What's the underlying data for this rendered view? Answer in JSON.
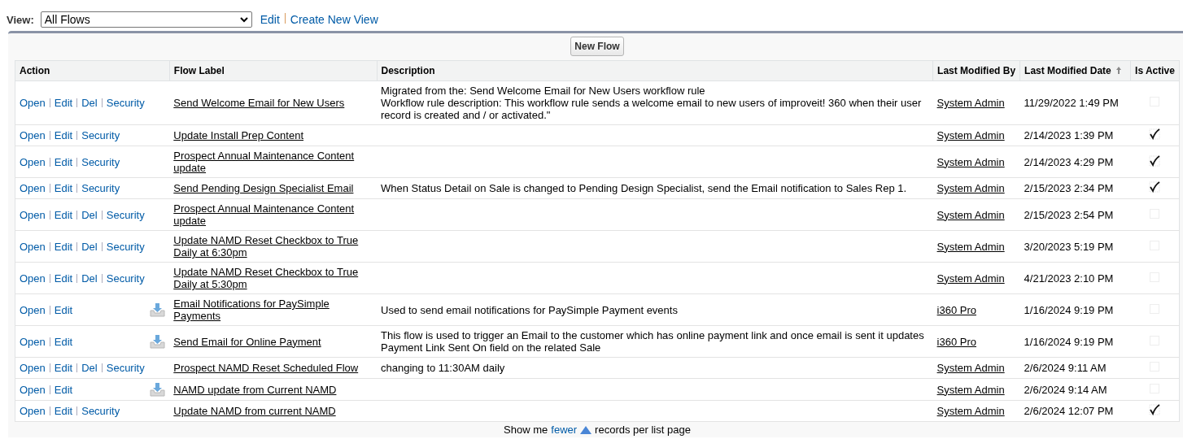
{
  "view_bar": {
    "label": "View:",
    "selected_view": "All Flows",
    "links": [
      "Edit",
      "Create New View"
    ]
  },
  "new_button": "New Flow",
  "table": {
    "columns": [
      {
        "label": "Action",
        "sorted": false
      },
      {
        "label": "Flow Label",
        "sorted": false
      },
      {
        "label": "Description",
        "sorted": false
      },
      {
        "label": "Last Modified By",
        "sorted": false
      },
      {
        "label": "Last Modified Date",
        "sorted": true
      },
      {
        "label": "Is Active",
        "sorted": false
      }
    ],
    "rows": [
      {
        "actions": [
          "Open",
          "Edit",
          "Del",
          "Security"
        ],
        "installed": false,
        "label": "Send Welcome Email for New Users",
        "description_lines": [
          "Migrated from the: Send Welcome Email for New Users workflow rule",
          "Workflow rule description: This workflow rule sends a welcome email to new users of improveit! 360 when their user record is created and / or activated.\""
        ],
        "modified_by": "System Admin",
        "modified_date": "11/29/2022 1:49 PM",
        "active": false
      },
      {
        "actions": [
          "Open",
          "Edit",
          "Security"
        ],
        "installed": false,
        "label": "Update Install Prep Content",
        "description_lines": [],
        "modified_by": "System Admin",
        "modified_date": "2/14/2023 1:39 PM",
        "active": true
      },
      {
        "actions": [
          "Open",
          "Edit",
          "Security"
        ],
        "installed": false,
        "label": "Prospect Annual Maintenance Content update",
        "description_lines": [],
        "modified_by": "System Admin",
        "modified_date": "2/14/2023 4:29 PM",
        "active": true
      },
      {
        "actions": [
          "Open",
          "Edit",
          "Security"
        ],
        "installed": false,
        "label": "Send Pending Design Specialist Email",
        "description_lines": [
          "When Status Detail on Sale is changed to Pending Design Specialist, send the Email notification to Sales Rep 1."
        ],
        "modified_by": "System Admin",
        "modified_date": "2/15/2023 2:34 PM",
        "active": true
      },
      {
        "actions": [
          "Open",
          "Edit",
          "Del",
          "Security"
        ],
        "installed": false,
        "label": "Prospect Annual Maintenance Content update",
        "description_lines": [],
        "modified_by": "System Admin",
        "modified_date": "2/15/2023 2:54 PM",
        "active": false
      },
      {
        "actions": [
          "Open",
          "Edit",
          "Del",
          "Security"
        ],
        "installed": false,
        "label": "Update NAMD Reset Checkbox to True Daily at 6:30pm",
        "description_lines": [],
        "modified_by": "System Admin",
        "modified_date": "3/20/2023 5:19 PM",
        "active": false
      },
      {
        "actions": [
          "Open",
          "Edit",
          "Del",
          "Security"
        ],
        "installed": false,
        "label": "Update NAMD Reset Checkbox to True Daily at 5:30pm",
        "description_lines": [],
        "modified_by": "System Admin",
        "modified_date": "4/21/2023 2:10 PM",
        "active": false
      },
      {
        "actions": [
          "Open",
          "Edit"
        ],
        "installed": true,
        "label": "Email Notifications for PaySimple Payments",
        "description_lines": [
          "Used to send email notifications for PaySimple Payment events"
        ],
        "modified_by": "i360 Pro",
        "modified_date": "1/16/2024 9:19 PM",
        "active": false
      },
      {
        "actions": [
          "Open",
          "Edit"
        ],
        "installed": true,
        "label": "Send Email for Online Payment",
        "description_lines": [
          "This flow is used to trigger an Email to the customer which has online payment link and once email is sent it updates Payment Link Sent On field on the related Sale"
        ],
        "modified_by": "i360 Pro",
        "modified_date": "1/16/2024 9:19 PM",
        "active": false
      },
      {
        "actions": [
          "Open",
          "Edit",
          "Del",
          "Security"
        ],
        "installed": false,
        "label": "Prospect NAMD Reset Scheduled Flow",
        "description_lines": [
          "changing to 11:30AM daily"
        ],
        "modified_by": "System Admin",
        "modified_date": "2/6/2024 9:11 AM",
        "active": false
      },
      {
        "actions": [
          "Open",
          "Edit"
        ],
        "installed": true,
        "label": "NAMD update from Current NAMD",
        "description_lines": [],
        "modified_by": "System Admin",
        "modified_date": "2/6/2024 9:14 AM",
        "active": false
      },
      {
        "actions": [
          "Open",
          "Edit",
          "Security"
        ],
        "installed": false,
        "label": "Update NAMD from current NAMD",
        "description_lines": [],
        "modified_by": "System Admin",
        "modified_date": "2/6/2024 12:07 PM",
        "active": true
      }
    ]
  },
  "footer": {
    "before": "Show me",
    "link": "fewer",
    "after": "records per list page"
  }
}
